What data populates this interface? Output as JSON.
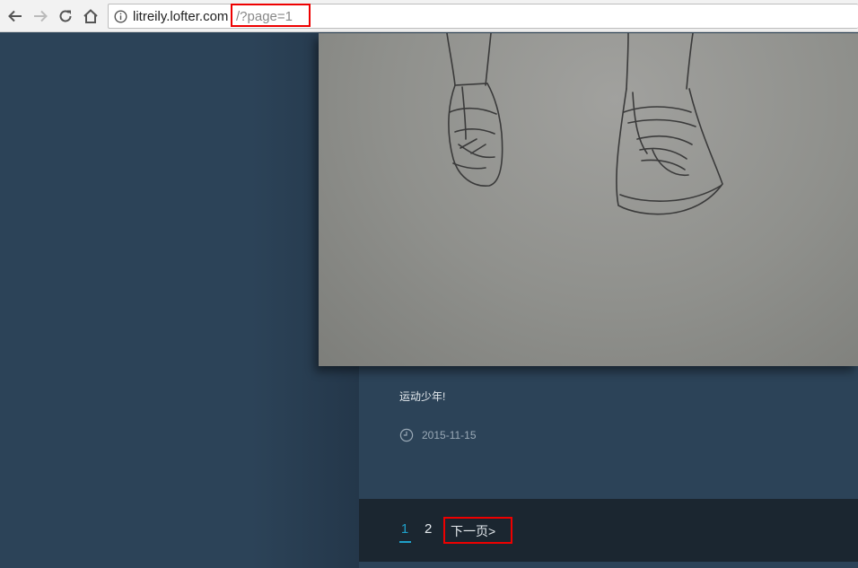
{
  "browser": {
    "url_host": "litreily.lofter.com",
    "url_path": "/?page=1",
    "icons": [
      "back-icon",
      "forward-icon",
      "reload-icon",
      "home-icon",
      "info-icon"
    ]
  },
  "post": {
    "caption": "运动少年!",
    "date": "2015-11-15"
  },
  "pagination": {
    "current": "1",
    "page_2": "2",
    "next_label": "下一页>"
  },
  "colors": {
    "background": "#2c4358",
    "pager_background": "#1b2630",
    "active_page": "#1fa0c9",
    "highlight": "#e00000"
  }
}
